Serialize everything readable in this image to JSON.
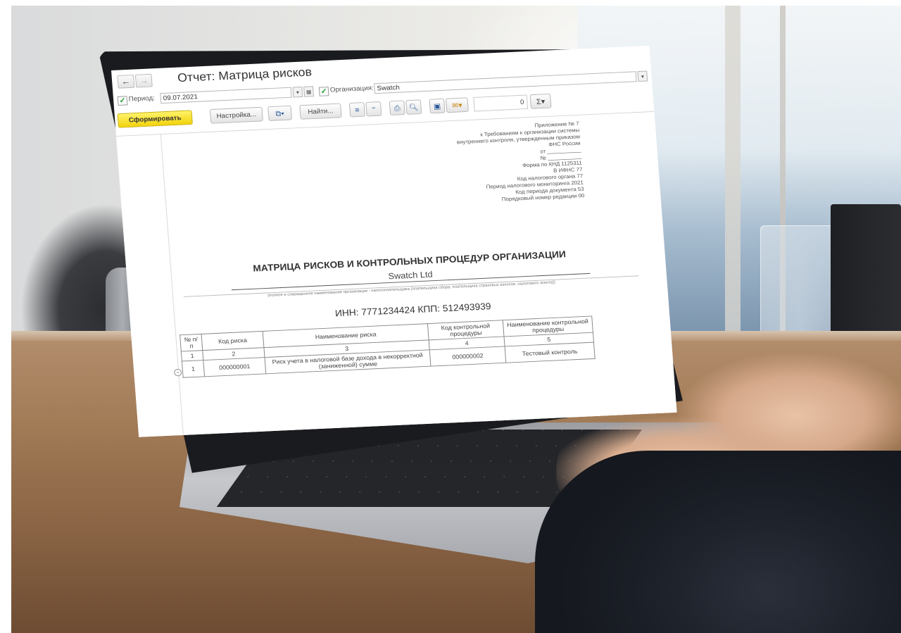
{
  "window": {
    "title": "Отчет: Матрица рисков",
    "nav_back": "←",
    "nav_forward": "→"
  },
  "filters": {
    "period_label": "Период:",
    "period_value": "09.07.2021",
    "org_label": "Организация:",
    "org_value": "Swatch"
  },
  "toolbar": {
    "generate_label": "Сформировать",
    "settings_label": "Настройка...",
    "find_label": "Найти...",
    "sum_value": "0",
    "sum_icon": "Σ"
  },
  "document": {
    "appendix_lines": [
      "Приложение № 7",
      "к Требованиям к организации системы",
      "внутреннего контроля, утвержденным приказом",
      "ФНС России",
      "от ___________",
      "№ ___________",
      "Форма по КНД 1125311",
      "В ИФНС 77",
      "Код налогового органа 77",
      "Период налогового мониторинга 2021",
      "Код периода документа 53",
      "Порядковый номер редакции 00"
    ],
    "title": "МАТРИЦА РИСКОВ И КОНТРОЛЬНЫХ ПРОЦЕДУР ОРГАНИЗАЦИИ",
    "org_name": "Swatch Ltd",
    "org_caption": "(полное и сокращенное наименование организации - налогоплательщика (плательщика сбора, плательщика страховых взносов, налогового агента))",
    "inn_kpp": "ИНН: 7771234424 КПП: 512493939",
    "table": {
      "headers": [
        "№ п/п",
        "Код риска",
        "Наименование риска",
        "Код контрольной процедуры",
        "Наименование контрольной процедуры"
      ],
      "col_numbers": [
        "1",
        "2",
        "3",
        "4",
        "5"
      ],
      "rows": [
        [
          "1",
          "000000001",
          "Риск учета в налоговой базе дохода в некорректной (заниженной) сумме",
          "000000002",
          "Тестовый контроль"
        ]
      ]
    }
  },
  "colors": {
    "generate_button": "#f2d30b",
    "checkbox_check": "#1a9a2a"
  },
  "icons": {
    "print": "printer-icon",
    "preview": "preview-icon",
    "save": "floppy-icon",
    "email": "envelope-icon",
    "calendar": "calendar-icon"
  }
}
